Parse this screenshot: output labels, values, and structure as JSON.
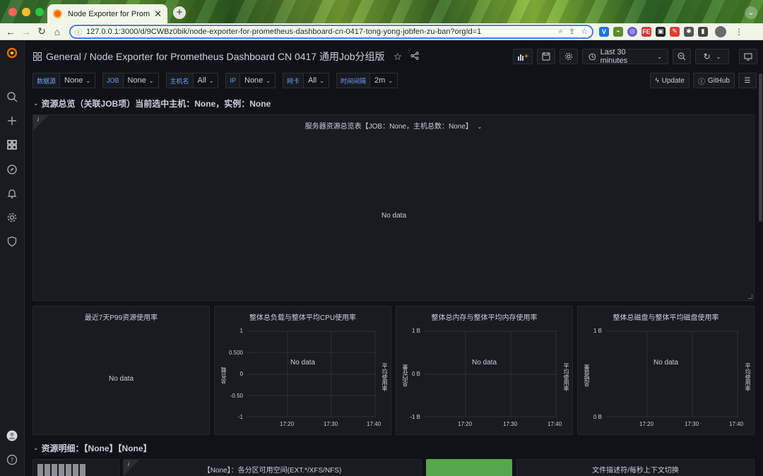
{
  "browser": {
    "tab_title": "Grafana Node Exporter for Prometheus",
    "tab_title_display": "Node Exporter for Prometheus",
    "url": "127.0.0.1:3000/d/9CWBz0bik/node-exporter-for-prometheus-dashboard-cn-0417-tong-yong-jobfen-zu-ban?orgId=1"
  },
  "breadcrumb": {
    "folder": "General",
    "separator": "/",
    "dashboard": "Node Exporter for Prometheus Dashboard CN 0417 通用Job分组版"
  },
  "toolbar": {
    "time_range": "Last 30 minutes"
  },
  "variables": [
    {
      "label": "数据源",
      "value": "None"
    },
    {
      "label": "JOB",
      "value": "None"
    },
    {
      "label": "主机名",
      "value": "All"
    },
    {
      "label": "IP",
      "value": "None"
    },
    {
      "label": "网卡",
      "value": "All"
    },
    {
      "label": "时间间隔",
      "value": "2m"
    }
  ],
  "links": {
    "update": "Update",
    "github": "GitHub"
  },
  "rows": {
    "overview": "资源总览（关联JOB项）当前选中主机：None，实例：None",
    "detail": "资源明细：【None】【None】"
  },
  "panels": {
    "server_table": {
      "title": "服务器资源总览表【JOB：None，主机总数：None】",
      "message": "No data"
    },
    "p99": {
      "title": "最近7天P99资源使用率",
      "message": "No data"
    },
    "cpu": {
      "title": "整体总负载与整体平均CPU使用率",
      "message": "No data",
      "y_ticks": [
        "1",
        "0.500",
        "0",
        "-0.50",
        "-1"
      ],
      "x_ticks": [
        "17:20",
        "17:30",
        "17:40"
      ],
      "y_left_label": "总负载",
      "y_right_label": "平均使用率"
    },
    "mem": {
      "title": "整体总内存与整体平均内存使用率",
      "message": "No data",
      "y_ticks": [
        "1 B",
        "0 B",
        "-1 B"
      ],
      "x_ticks": [
        "17:20",
        "17:30",
        "17:40"
      ],
      "y_left_label": "总内存量",
      "y_right_label": "平均使用率"
    },
    "disk": {
      "title": "整体总磁盘与整体平均磁盘使用率",
      "message": "No data",
      "y_ticks": [
        "1 B",
        "0 B"
      ],
      "x_ticks": [
        "17:20",
        "17:30",
        "17:40"
      ],
      "y_left_label": "总磁盘量",
      "y_right_label": "平均使用率"
    },
    "partition": {
      "title": "【None】：各分区可用空间(EXT.*/XFS/NFS)"
    },
    "fd": {
      "title": "文件描述符/每秒上下文切换"
    }
  },
  "colors": {
    "background": "#111217",
    "panel": "#181b1f",
    "accent_blue": "#6e9fff",
    "green_panel": "#56a64b"
  }
}
